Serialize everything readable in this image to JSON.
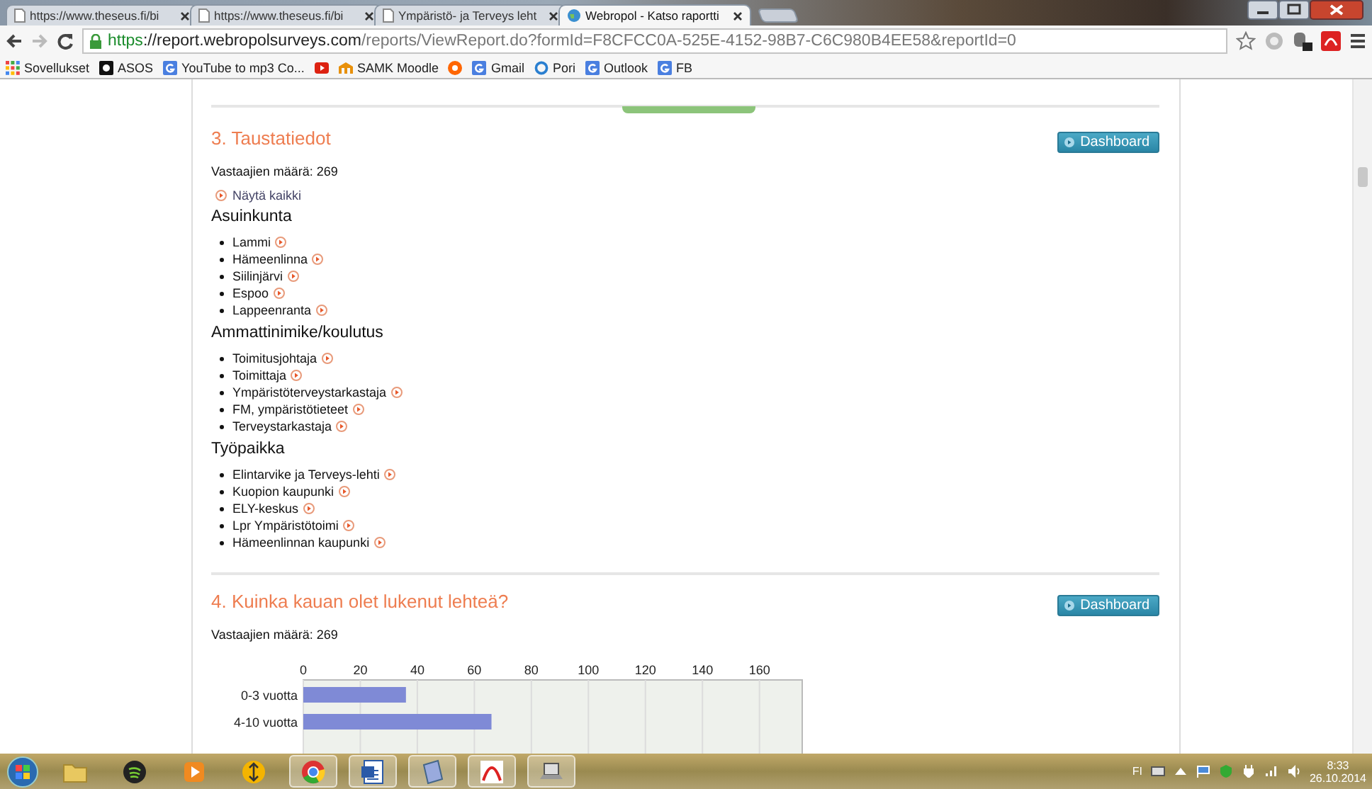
{
  "browser": {
    "tabs": [
      {
        "title": "https://www.theseus.fi/bi",
        "selected": false
      },
      {
        "title": "https://www.theseus.fi/bi",
        "selected": false
      },
      {
        "title": "Ympäristö- ja Terveys leht",
        "selected": false
      },
      {
        "title": "Webropol - Katso raportti",
        "selected": true
      }
    ],
    "url": {
      "scheme": "https",
      "host": "://report.webropolsurveys.com",
      "path": "/reports/ViewReport.do?formId=F8CFCC0A-525E-4152-98B7-C6C980B4EE58&reportId=0"
    },
    "bookmarks": [
      {
        "kind": "apps",
        "label": "Sovellukset"
      },
      {
        "kind": "dark",
        "label": "ASOS"
      },
      {
        "kind": "google",
        "label": "YouTube to mp3 Co..."
      },
      {
        "kind": "video"
      },
      {
        "kind": "moodle",
        "label": "SAMK Moodle"
      },
      {
        "kind": "orange"
      },
      {
        "kind": "google",
        "label": "Gmail"
      },
      {
        "kind": "ring",
        "label": "Pori"
      },
      {
        "kind": "google",
        "label": "Outlook"
      },
      {
        "kind": "google",
        "label": "FB"
      }
    ]
  },
  "sections": [
    {
      "title": "3. Taustatiedot",
      "button": "Dashboard",
      "respondents": "Vastaajien määrä: 269",
      "show_all": "Näytä kaikki",
      "groups": [
        {
          "heading": "Asuinkunta",
          "items": [
            "Lammi",
            "Hämeenlinna",
            "Siilinjärvi",
            "Espoo",
            "Lappeenranta"
          ]
        },
        {
          "heading": "Ammattinimike/koulutus",
          "items": [
            "Toimitusjohtaja",
            "Toimittaja",
            "Ympäristöterveystarkastaja",
            "FM, ympäristötieteet",
            "Terveystarkastaja"
          ]
        },
        {
          "heading": "Työpaikka",
          "items": [
            "Elintarvike ja Terveys-lehti",
            "Kuopion kaupunki",
            "ELY-keskus",
            "Lpr Ympäristötoimi",
            "Hämeenlinnan kaupunki"
          ]
        }
      ]
    },
    {
      "title": "4. Kuinka kauan olet lukenut lehteä?",
      "button": "Dashboard",
      "respondents": "Vastaajien määrä: 269",
      "chart_data": {
        "type": "bar",
        "orientation": "horizontal",
        "categories": [
          "0-3 vuotta",
          "4-10 vuotta"
        ],
        "values": [
          36,
          66
        ],
        "grid": true,
        "xlim": [
          0,
          175
        ],
        "xticks": [
          0,
          20,
          40,
          60,
          80,
          100,
          120,
          140,
          160
        ]
      }
    }
  ],
  "taskbar": {
    "apps": [
      {
        "kind": "folder",
        "running": false
      },
      {
        "kind": "spotify",
        "running": false
      },
      {
        "kind": "media",
        "running": false
      },
      {
        "kind": "arrows",
        "running": false
      },
      {
        "kind": "chrome",
        "running": true
      },
      {
        "kind": "word",
        "running": true
      },
      {
        "kind": "notes",
        "running": true
      },
      {
        "kind": "pdf",
        "running": true
      },
      {
        "kind": "laptop",
        "running": true
      }
    ],
    "language": "FI",
    "time": "8:33",
    "date": "26.10.2014"
  }
}
